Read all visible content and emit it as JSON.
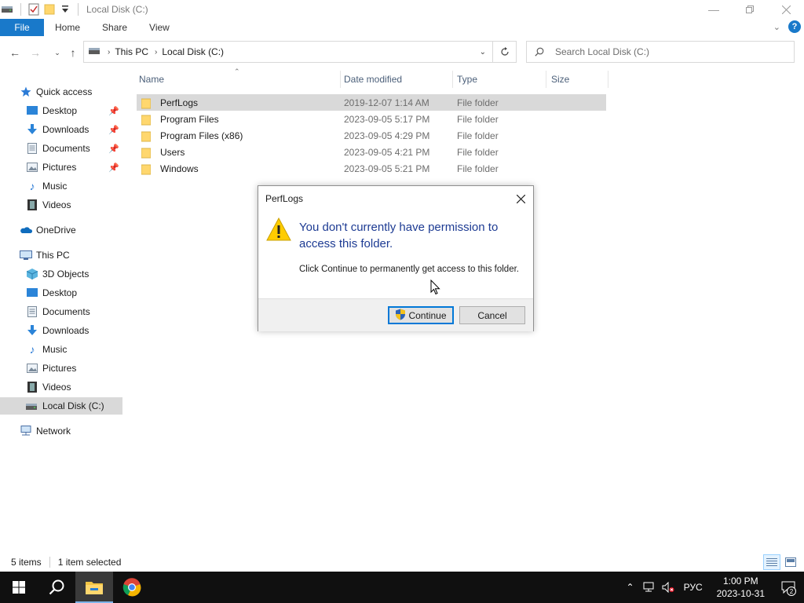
{
  "window": {
    "title": "Local Disk (C:)",
    "minimize_icon": "minimize-icon",
    "restore_icon": "restore-icon",
    "close_icon": "close-icon"
  },
  "ribbon": {
    "file_tab": "File",
    "tabs": [
      "Home",
      "Share",
      "View"
    ],
    "accent_color": "#1979ca"
  },
  "address_bar": {
    "segments": [
      "This PC",
      "Local Disk (C:)"
    ]
  },
  "search": {
    "placeholder": "Search Local Disk (C:)"
  },
  "sidebar": {
    "quick_access": "Quick access",
    "quick_items": [
      {
        "label": "Desktop",
        "icon": "desktop-icon",
        "pinned": true
      },
      {
        "label": "Downloads",
        "icon": "downloads-icon",
        "pinned": true
      },
      {
        "label": "Documents",
        "icon": "documents-icon",
        "pinned": true
      },
      {
        "label": "Pictures",
        "icon": "pictures-icon",
        "pinned": true
      },
      {
        "label": "Music",
        "icon": "music-icon",
        "pinned": false
      },
      {
        "label": "Videos",
        "icon": "videos-icon",
        "pinned": false
      }
    ],
    "onedrive": "OneDrive",
    "this_pc": "This PC",
    "pc_items": [
      {
        "label": "3D Objects",
        "icon": "3d-objects-icon"
      },
      {
        "label": "Desktop",
        "icon": "desktop-icon"
      },
      {
        "label": "Documents",
        "icon": "documents-icon"
      },
      {
        "label": "Downloads",
        "icon": "downloads-icon"
      },
      {
        "label": "Music",
        "icon": "music-icon"
      },
      {
        "label": "Pictures",
        "icon": "pictures-icon"
      },
      {
        "label": "Videos",
        "icon": "videos-icon"
      },
      {
        "label": "Local Disk (C:)",
        "icon": "drive-icon",
        "selected": true
      }
    ],
    "network": "Network"
  },
  "file_list": {
    "columns": [
      "Name",
      "Date modified",
      "Type",
      "Size"
    ],
    "rows": [
      {
        "name": "PerfLogs",
        "date": "2019-12-07 1:14 AM",
        "type": "File folder",
        "size": "",
        "selected": true
      },
      {
        "name": "Program Files",
        "date": "2023-09-05 5:17 PM",
        "type": "File folder",
        "size": ""
      },
      {
        "name": "Program Files (x86)",
        "date": "2023-09-05 4:29 PM",
        "type": "File folder",
        "size": ""
      },
      {
        "name": "Users",
        "date": "2023-09-05 4:21 PM",
        "type": "File folder",
        "size": ""
      },
      {
        "name": "Windows",
        "date": "2023-09-05 5:21 PM",
        "type": "File folder",
        "size": ""
      }
    ]
  },
  "status": {
    "item_count": "5 items",
    "selection": "1 item selected"
  },
  "dialog": {
    "title": "PerfLogs",
    "main_instruction": "You don't currently have permission to access this folder.",
    "content": "Click Continue to permanently get access to this folder.",
    "continue_label": "Continue",
    "cancel_label": "Cancel",
    "main_color": "#1d3b93"
  },
  "taskbar": {
    "apps": [
      "start-icon",
      "search-icon",
      "file-explorer-icon",
      "chrome-icon"
    ],
    "language": "РУС",
    "time": "1:00 PM",
    "date": "2023-10-31",
    "notification_count": "2"
  }
}
